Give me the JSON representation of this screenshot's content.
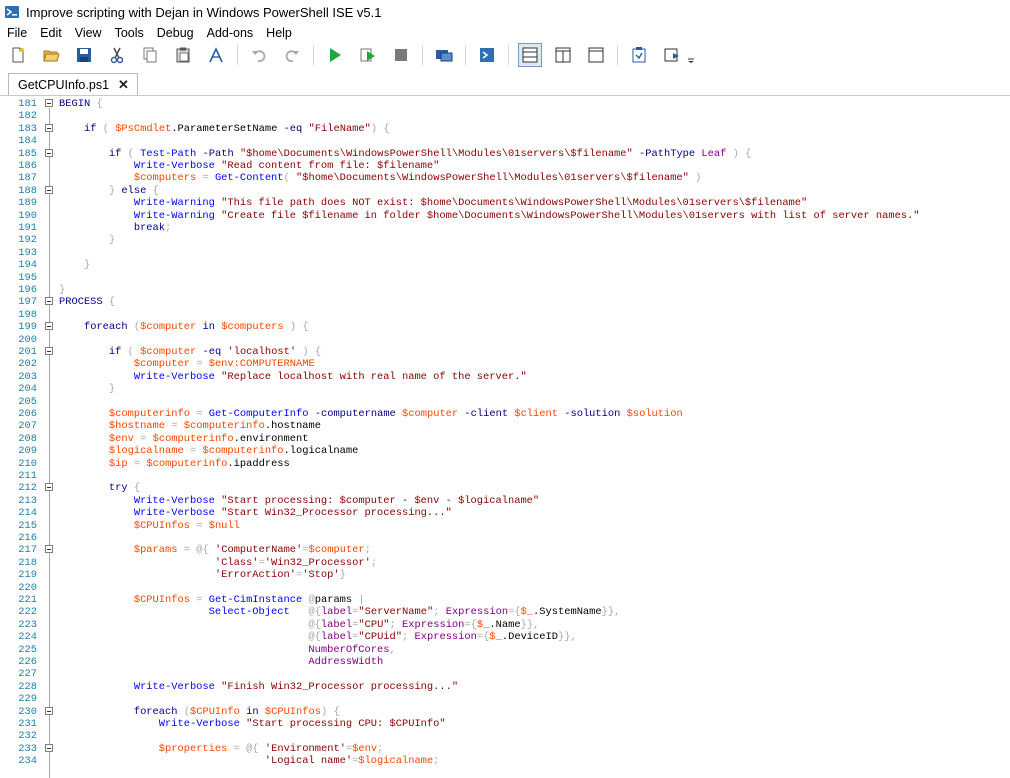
{
  "window": {
    "title": "Improve scripting with Dejan in Windows PowerShell ISE v5.1"
  },
  "menu": [
    "File",
    "Edit",
    "View",
    "Tools",
    "Debug",
    "Add-ons",
    "Help"
  ],
  "toolbar": {
    "icons": [
      "new-icon",
      "open-icon",
      "save-icon",
      "cut-icon",
      "copy-icon",
      "paste-icon",
      "clear-console-icon",
      "undo-icon",
      "redo-icon",
      "run-script-icon",
      "run-selection-icon",
      "stop-icon",
      "remote-powershell-icon",
      "powershell-console-icon",
      "layout-top-icon",
      "layout-right-icon",
      "layout-max-icon",
      "show-commands-icon",
      "show-script-pane-icon",
      "toolbar-overflow-icon"
    ]
  },
  "tab": {
    "label": "GetCPUInfo.ps1",
    "close": "✕"
  },
  "code": {
    "lines": [
      {
        "num": "181",
        "fold": true,
        "html": "BEGIN {"
      },
      {
        "num": "182",
        "fold": false,
        "html": ""
      },
      {
        "num": "183",
        "fold": true,
        "html": "    if ( $PsCmdlet.ParameterSetName -eq \"FileName\") {"
      },
      {
        "num": "184",
        "fold": false,
        "html": ""
      },
      {
        "num": "185",
        "fold": true,
        "html": "        if ( Test-Path -Path \"$home\\Documents\\WindowsPowerShell\\Modules\\01servers\\$filename\" -PathType Leaf ) {"
      },
      {
        "num": "186",
        "fold": false,
        "html": "            Write-Verbose \"Read content from file: $filename\""
      },
      {
        "num": "187",
        "fold": false,
        "html": "            $computers = Get-Content( \"$home\\Documents\\WindowsPowerShell\\Modules\\01servers\\$filename\" )"
      },
      {
        "num": "188",
        "fold": true,
        "html": "        } else {"
      },
      {
        "num": "189",
        "fold": false,
        "html": "            Write-Warning \"This file path does NOT exist: $home\\Documents\\WindowsPowerShell\\Modules\\01servers\\$filename\""
      },
      {
        "num": "190",
        "fold": false,
        "html": "            Write-Warning \"Create file $filename in folder $home\\Documents\\WindowsPowerShell\\Modules\\01servers with list of server names.\""
      },
      {
        "num": "191",
        "fold": false,
        "html": "            break;"
      },
      {
        "num": "192",
        "fold": false,
        "html": "        }"
      },
      {
        "num": "193",
        "fold": false,
        "html": ""
      },
      {
        "num": "194",
        "fold": false,
        "html": "    }"
      },
      {
        "num": "195",
        "fold": false,
        "html": ""
      },
      {
        "num": "196",
        "fold": false,
        "html": "}"
      },
      {
        "num": "197",
        "fold": true,
        "html": "PROCESS {"
      },
      {
        "num": "198",
        "fold": false,
        "html": ""
      },
      {
        "num": "199",
        "fold": true,
        "html": "    foreach ($computer in $computers ) {"
      },
      {
        "num": "200",
        "fold": false,
        "html": ""
      },
      {
        "num": "201",
        "fold": true,
        "html": "        if ( $computer -eq 'localhost' ) {"
      },
      {
        "num": "202",
        "fold": false,
        "html": "            $computer = $env:COMPUTERNAME"
      },
      {
        "num": "203",
        "fold": false,
        "html": "            Write-Verbose \"Replace localhost with real name of the server.\""
      },
      {
        "num": "204",
        "fold": false,
        "html": "        }"
      },
      {
        "num": "205",
        "fold": false,
        "html": ""
      },
      {
        "num": "206",
        "fold": false,
        "html": "        $computerinfo = Get-ComputerInfo -computername $computer -client $client -solution $solution"
      },
      {
        "num": "207",
        "fold": false,
        "html": "        $hostname = $computerinfo.hostname"
      },
      {
        "num": "208",
        "fold": false,
        "html": "        $env = $computerinfo.environment"
      },
      {
        "num": "209",
        "fold": false,
        "html": "        $logicalname = $computerinfo.logicalname"
      },
      {
        "num": "210",
        "fold": false,
        "html": "        $ip = $computerinfo.ipaddress"
      },
      {
        "num": "211",
        "fold": false,
        "html": ""
      },
      {
        "num": "212",
        "fold": true,
        "html": "        try {"
      },
      {
        "num": "213",
        "fold": false,
        "html": "            Write-Verbose \"Start processing: $computer - $env - $logicalname\""
      },
      {
        "num": "214",
        "fold": false,
        "html": "            Write-Verbose \"Start Win32_Processor processing...\""
      },
      {
        "num": "215",
        "fold": false,
        "html": "            $CPUInfos = $null"
      },
      {
        "num": "216",
        "fold": false,
        "html": ""
      },
      {
        "num": "217",
        "fold": true,
        "html": "            $params = @{ 'ComputerName'=$computer;"
      },
      {
        "num": "218",
        "fold": false,
        "html": "                         'Class'='Win32_Processor';"
      },
      {
        "num": "219",
        "fold": false,
        "html": "                         'ErrorAction'='Stop'}"
      },
      {
        "num": "220",
        "fold": false,
        "html": ""
      },
      {
        "num": "221",
        "fold": false,
        "html": "            $CPUInfos = Get-CimInstance @params |"
      },
      {
        "num": "222",
        "fold": false,
        "html": "                        Select-Object   @{label=\"ServerName\"; Expression={$_.SystemName}},"
      },
      {
        "num": "223",
        "fold": false,
        "html": "                                        @{label=\"CPU\"; Expression={$_.Name}},"
      },
      {
        "num": "224",
        "fold": false,
        "html": "                                        @{label=\"CPUid\"; Expression={$_.DeviceID}},"
      },
      {
        "num": "225",
        "fold": false,
        "html": "                                        NumberOfCores,"
      },
      {
        "num": "226",
        "fold": false,
        "html": "                                        AddressWidth"
      },
      {
        "num": "227",
        "fold": false,
        "html": ""
      },
      {
        "num": "228",
        "fold": false,
        "html": "            Write-Verbose \"Finish Win32_Processor processing...\""
      },
      {
        "num": "229",
        "fold": false,
        "html": ""
      },
      {
        "num": "230",
        "fold": true,
        "html": "            foreach ($CPUInfo in $CPUInfos) {"
      },
      {
        "num": "231",
        "fold": false,
        "html": "                Write-Verbose \"Start processing CPU: $CPUInfo\""
      },
      {
        "num": "232",
        "fold": false,
        "html": ""
      },
      {
        "num": "233",
        "fold": true,
        "html": "                $properties = @{ 'Environment'=$env;"
      },
      {
        "num": "234",
        "fold": false,
        "html": "                                 'Logical name'=$logicalname;"
      }
    ]
  }
}
